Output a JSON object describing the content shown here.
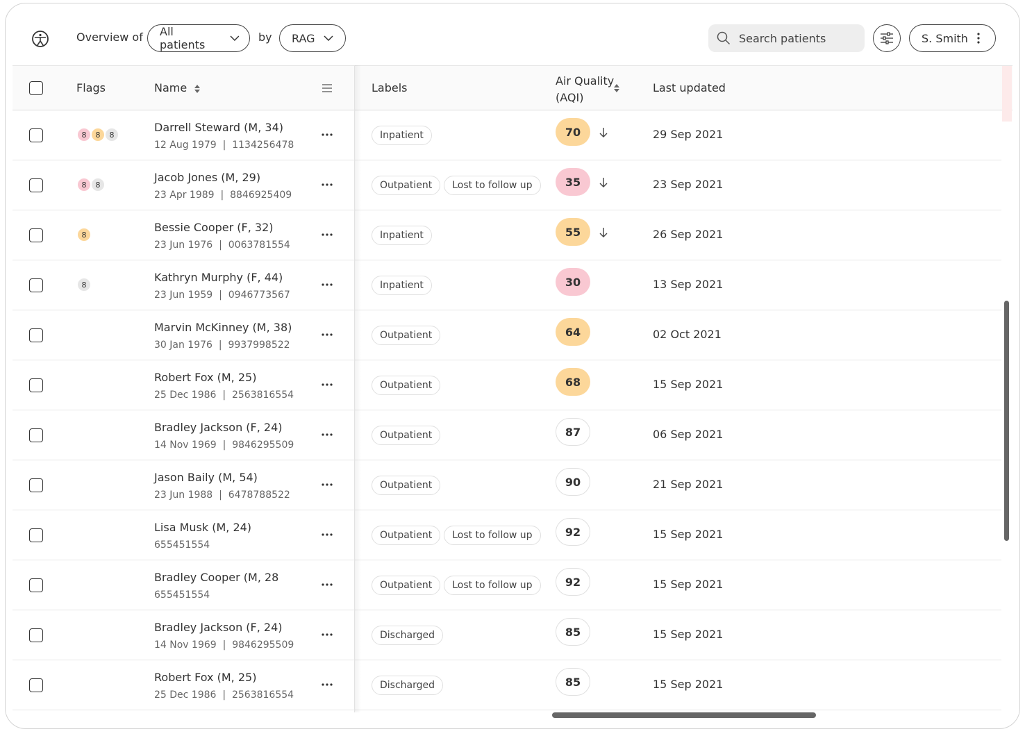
{
  "header": {
    "overview_label": "Overview of",
    "filter_value": "All patients",
    "by_label": "by",
    "group_value": "RAG",
    "search_placeholder": "Search patients",
    "user_name": "S. Smith"
  },
  "table": {
    "columns": {
      "flags": "Flags",
      "name": "Name",
      "labels": "Labels",
      "aqi": "Air Quality",
      "aqi_unit": "(AQI)",
      "updated": "Last updated"
    },
    "rows": [
      {
        "name": "Darrell Steward (M, 34)",
        "dob": "12 Aug 1979",
        "id": "1134256478",
        "flags": [
          {
            "n": "8",
            "c": "red"
          },
          {
            "n": "8",
            "c": "amber"
          },
          {
            "n": "8",
            "c": "grey"
          }
        ],
        "labels": [
          "Inpatient"
        ],
        "aqi": "70",
        "aqi_c": "amber",
        "arrow": true,
        "updated": "29 Sep 2021"
      },
      {
        "name": "Jacob Jones (M, 29)",
        "dob": "23 Apr 1989",
        "id": "8846925409",
        "flags": [
          {
            "n": "8",
            "c": "red"
          },
          {
            "n": "8",
            "c": "grey"
          }
        ],
        "labels": [
          "Outpatient",
          "Lost to follow up"
        ],
        "aqi": "35",
        "aqi_c": "red",
        "arrow": true,
        "updated": "23 Sep 2021"
      },
      {
        "name": "Bessie Cooper (F, 32)",
        "dob": "23 Jun 1976",
        "id": "0063781554",
        "flags": [
          {
            "n": "8",
            "c": "amber"
          }
        ],
        "labels": [
          "Inpatient"
        ],
        "aqi": "55",
        "aqi_c": "amber",
        "arrow": true,
        "updated": "26 Sep 2021"
      },
      {
        "name": "Kathryn Murphy (F, 44)",
        "dob": "23 Jun 1959",
        "id": "0946773567",
        "flags": [
          {
            "n": "8",
            "c": "grey"
          }
        ],
        "labels": [
          "Inpatient"
        ],
        "aqi": "30",
        "aqi_c": "red",
        "arrow": false,
        "updated": "13 Sep 2021"
      },
      {
        "name": "Marvin McKinney (M, 38)",
        "dob": "30 Jan 1976",
        "id": "9937998522",
        "flags": [],
        "labels": [
          "Outpatient"
        ],
        "aqi": "64",
        "aqi_c": "amber",
        "arrow": false,
        "updated": "02 Oct 2021"
      },
      {
        "name": "Robert Fox (M, 25)",
        "dob": "25 Dec 1986",
        "id": "2563816554",
        "flags": [],
        "labels": [
          "Outpatient"
        ],
        "aqi": "68",
        "aqi_c": "amber",
        "arrow": false,
        "updated": "15 Sep 2021"
      },
      {
        "name": "Bradley Jackson (F, 24)",
        "dob": "14 Nov 1969",
        "id": "9846295509",
        "flags": [],
        "labels": [
          "Outpatient"
        ],
        "aqi": "87",
        "aqi_c": "none",
        "arrow": false,
        "updated": "06 Sep 2021"
      },
      {
        "name": "Jason Baily (M, 54)",
        "dob": "23 Jun 1988",
        "id": "6478788522",
        "flags": [],
        "labels": [
          "Outpatient"
        ],
        "aqi": "90",
        "aqi_c": "none",
        "arrow": false,
        "updated": "21 Sep 2021"
      },
      {
        "name": "Lisa Musk (M, 24)",
        "dob": "",
        "id": "655451554",
        "flags": [],
        "labels": [
          "Outpatient",
          "Lost to follow up"
        ],
        "aqi": "92",
        "aqi_c": "none",
        "arrow": false,
        "updated": "15 Sep 2021"
      },
      {
        "name": "Bradley Cooper (M, 28",
        "dob": "",
        "id": "655451554",
        "flags": [],
        "labels": [
          "Outpatient",
          "Lost to follow up"
        ],
        "aqi": "92",
        "aqi_c": "none",
        "arrow": false,
        "updated": "15 Sep 2021"
      },
      {
        "name": "Bradley Jackson (F, 24)",
        "dob": "14 Nov 1969",
        "id": "9846295509",
        "flags": [],
        "labels": [
          "Discharged"
        ],
        "aqi": "85",
        "aqi_c": "none",
        "arrow": false,
        "updated": "15 Sep 2021"
      },
      {
        "name": "Robert Fox (M, 25)",
        "dob": "25 Dec 1986",
        "id": "2563816554",
        "flags": [],
        "labels": [
          "Discharged"
        ],
        "aqi": "85",
        "aqi_c": "none",
        "arrow": false,
        "updated": "15 Sep 2021"
      }
    ]
  }
}
